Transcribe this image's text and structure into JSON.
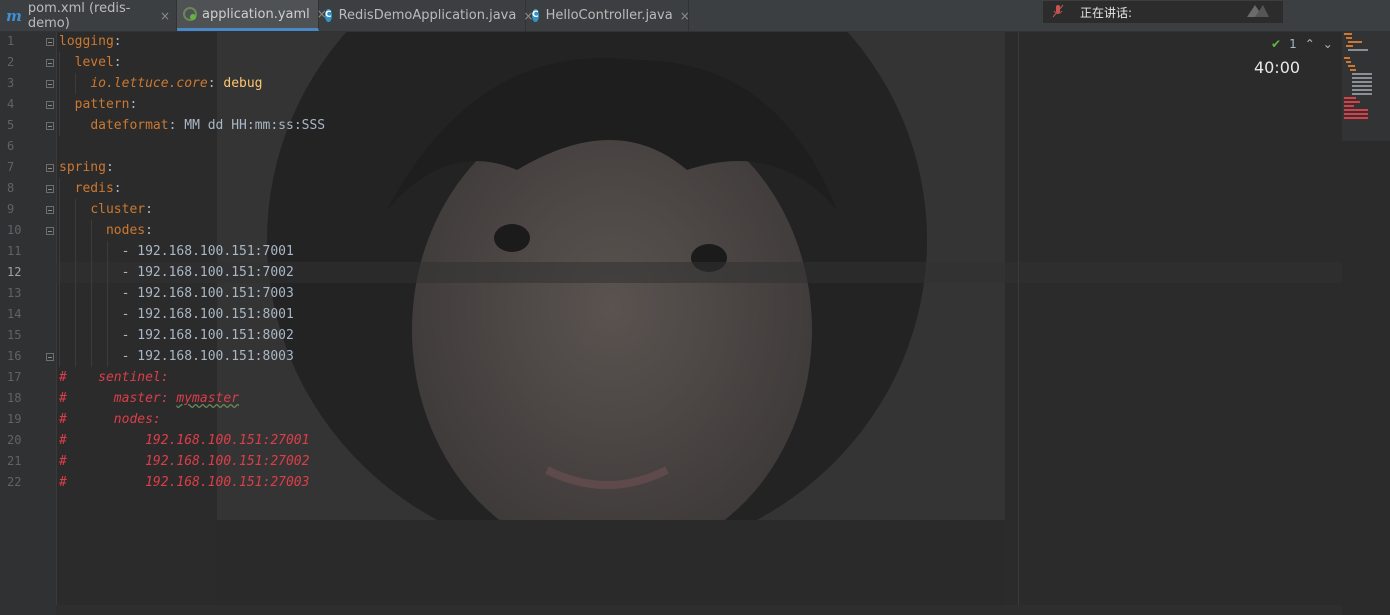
{
  "tabs": [
    {
      "icon": "maven-icon",
      "label": "pom.xml (redis-demo)",
      "active": false
    },
    {
      "icon": "yaml-spring-icon",
      "label": "application.yaml",
      "active": true
    },
    {
      "icon": "java-class-run-icon",
      "label": "RedisDemoApplication.java",
      "active": false
    },
    {
      "icon": "java-class-icon",
      "label": "HelloController.java",
      "active": false
    }
  ],
  "tab_close_glyph": "×",
  "overlay": {
    "speaking_label": "正在讲话:",
    "timer": "40:00"
  },
  "inspection": {
    "count": "1"
  },
  "editor": {
    "current_line": 12,
    "lines": [
      {
        "n": "1"
      },
      {
        "n": "2"
      },
      {
        "n": "3"
      },
      {
        "n": "4"
      },
      {
        "n": "5"
      },
      {
        "n": "6"
      },
      {
        "n": "7"
      },
      {
        "n": "8"
      },
      {
        "n": "9"
      },
      {
        "n": "10"
      },
      {
        "n": "11"
      },
      {
        "n": "12"
      },
      {
        "n": "13"
      },
      {
        "n": "14"
      },
      {
        "n": "15"
      },
      {
        "n": "16"
      },
      {
        "n": "17"
      },
      {
        "n": "18"
      },
      {
        "n": "19"
      },
      {
        "n": "20"
      },
      {
        "n": "21"
      },
      {
        "n": "22"
      }
    ],
    "code": {
      "l1_key": "logging",
      "l2_key": "level",
      "l3_key": "io.lettuce.core",
      "l3_val": "debug",
      "l4_key": "pattern",
      "l5_key": "dateformat",
      "l5_val": "MM dd HH:mm:ss:SSS",
      "l7_key": "spring",
      "l8_key": "redis",
      "l9_key": "cluster",
      "l10_key": "nodes",
      "nodes": [
        "192.168.100.151:7001",
        "192.168.100.151:7002",
        "192.168.100.151:7003",
        "192.168.100.151:8001",
        "192.168.100.151:8002",
        "192.168.100.151:8003"
      ],
      "c17": "#    sentinel:",
      "c18_a": "#      master: ",
      "c18_b": "mymaster",
      "c19": "#      nodes:",
      "c20": "#          192.168.100.151:27001",
      "c21": "#          192.168.100.151:27002",
      "c22": "#          192.168.100.151:27003"
    }
  },
  "colors": {
    "keyword": "#cc7832",
    "text": "#a9b7c6",
    "comment": "#dc3e48",
    "tab_accent": "#4a88c7",
    "background": "#2b2b2b"
  }
}
